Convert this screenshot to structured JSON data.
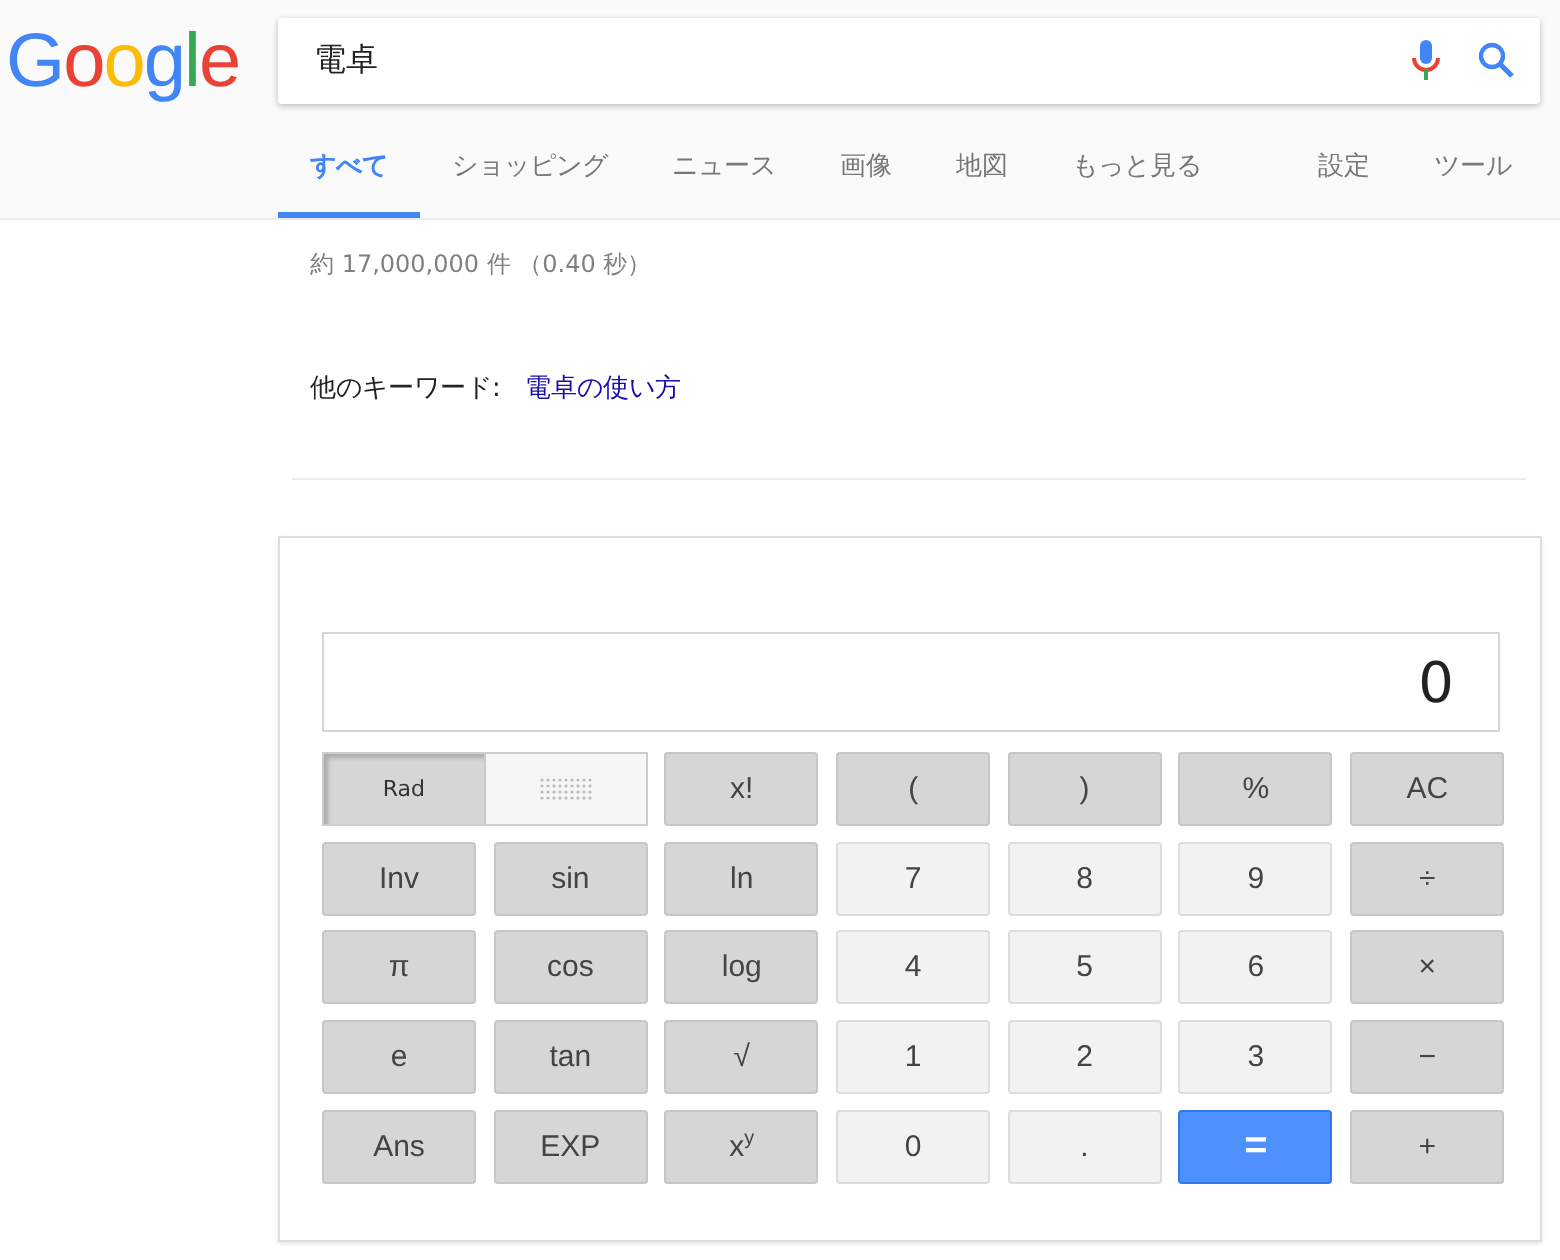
{
  "logo": "Google",
  "search": {
    "value": "電卓"
  },
  "tabs": [
    {
      "label": "すべて",
      "selected": true
    },
    {
      "label": "ショッピング",
      "selected": false
    },
    {
      "label": "ニュース",
      "selected": false
    },
    {
      "label": "画像",
      "selected": false
    },
    {
      "label": "地図",
      "selected": false
    },
    {
      "label": "もっと見る",
      "selected": false
    }
  ],
  "tools": [
    "設定",
    "ツール"
  ],
  "result_stats": "約 17,000,000 件 （0.40 秒）",
  "related": {
    "label": "他のキーワード:",
    "link": "電卓の使い方"
  },
  "calculator": {
    "display": "0",
    "angle_toggle": {
      "label": "Rad",
      "selected": true
    },
    "keys": [
      {
        "label": "x!",
        "kind": "fn"
      },
      {
        "label": "(",
        "kind": "fn"
      },
      {
        "label": ")",
        "kind": "fn"
      },
      {
        "label": "%",
        "kind": "fn"
      },
      {
        "label": "AC",
        "kind": "fn"
      },
      {
        "label": "Inv",
        "kind": "fn"
      },
      {
        "label": "sin",
        "kind": "fn"
      },
      {
        "label": "ln",
        "kind": "fn"
      },
      {
        "label": "7",
        "kind": "num"
      },
      {
        "label": "8",
        "kind": "num"
      },
      {
        "label": "9",
        "kind": "num"
      },
      {
        "label": "÷",
        "kind": "fn"
      },
      {
        "label": "π",
        "kind": "fn"
      },
      {
        "label": "cos",
        "kind": "fn"
      },
      {
        "label": "log",
        "kind": "fn"
      },
      {
        "label": "4",
        "kind": "num"
      },
      {
        "label": "5",
        "kind": "num"
      },
      {
        "label": "6",
        "kind": "num"
      },
      {
        "label": "×",
        "kind": "fn"
      },
      {
        "label": "e",
        "kind": "fn"
      },
      {
        "label": "tan",
        "kind": "fn"
      },
      {
        "label": "√",
        "kind": "fn"
      },
      {
        "label": "1",
        "kind": "num"
      },
      {
        "label": "2",
        "kind": "num"
      },
      {
        "label": "3",
        "kind": "num"
      },
      {
        "label": "−",
        "kind": "fn"
      },
      {
        "label": "Ans",
        "kind": "fn"
      },
      {
        "label": "EXP",
        "kind": "fn"
      },
      {
        "label": "x$^{y}$",
        "kind": "fn"
      },
      {
        "label": "0",
        "kind": "num"
      },
      {
        "label": ".",
        "kind": "num"
      },
      {
        "label": "=",
        "kind": "eq"
      },
      {
        "label": "+",
        "kind": "fn"
      }
    ]
  }
}
